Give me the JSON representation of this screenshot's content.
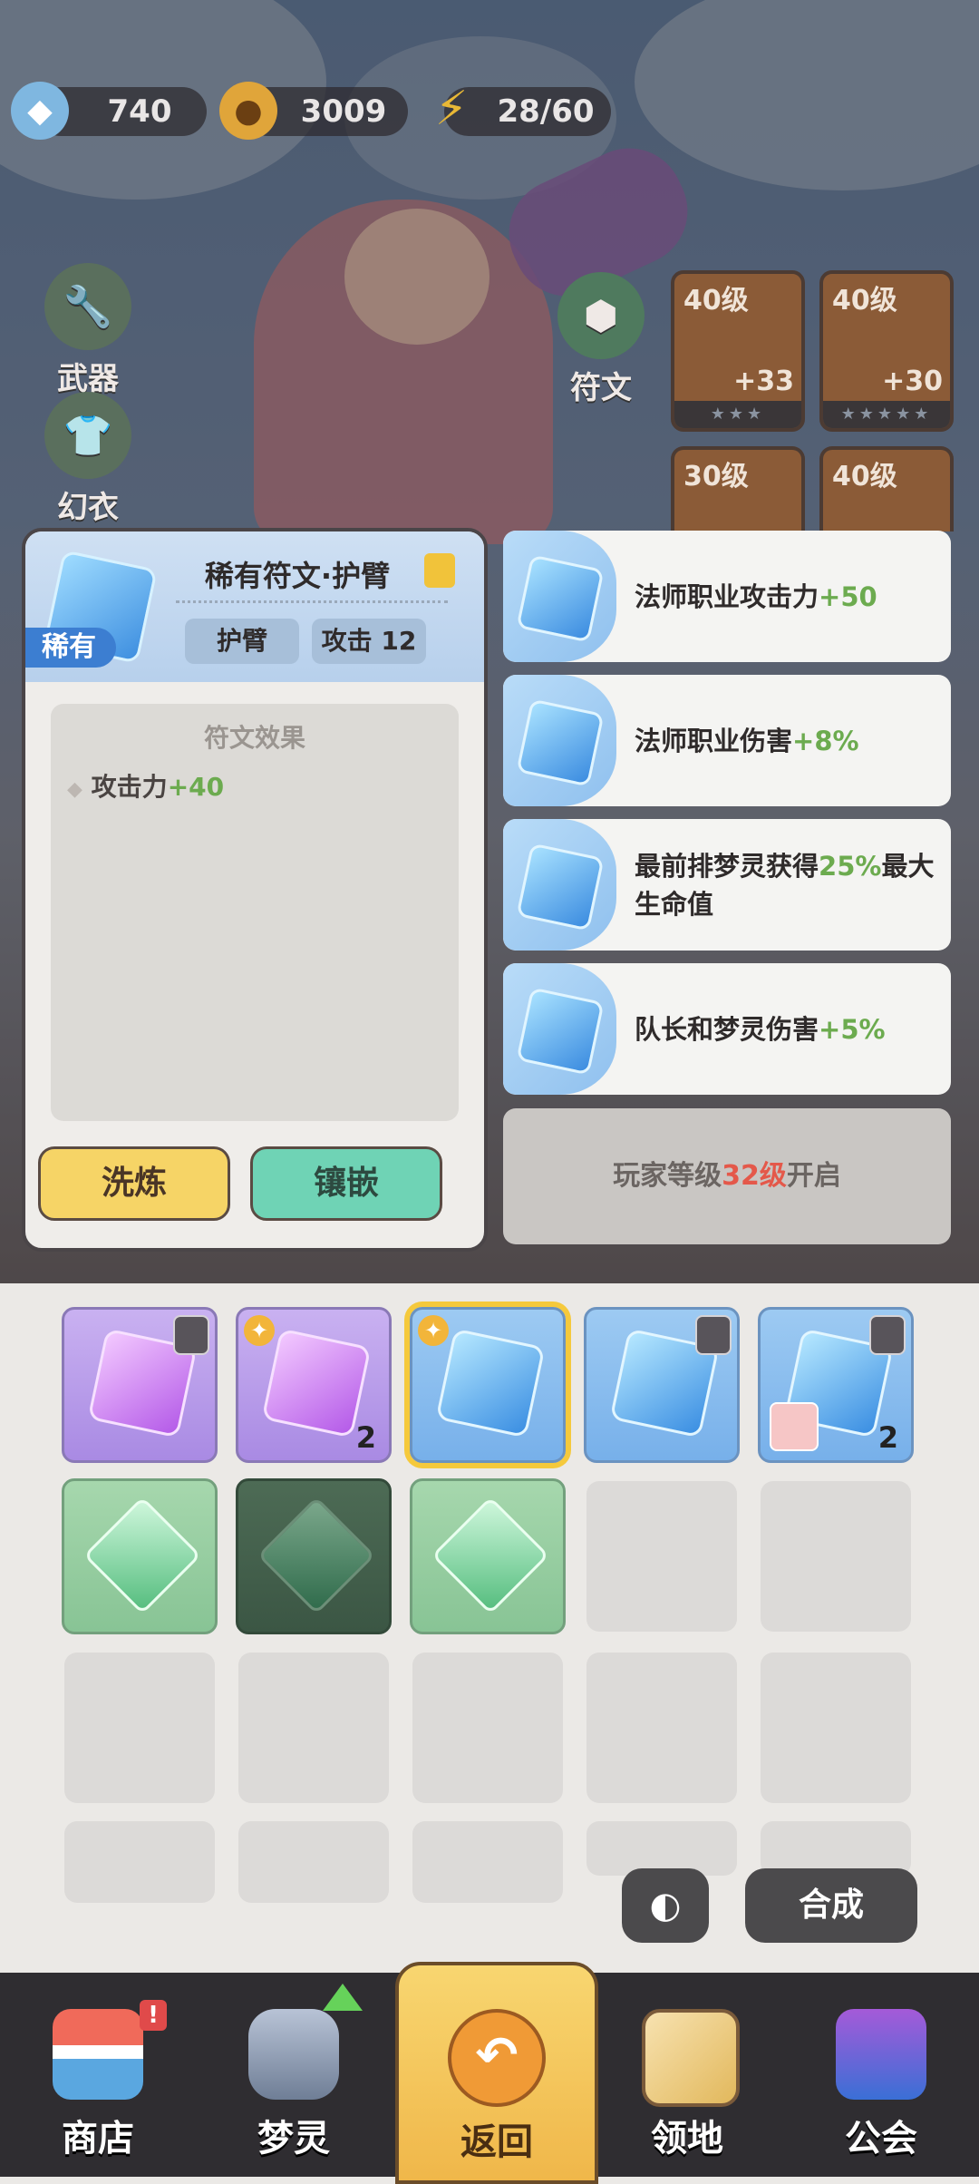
{
  "currency": {
    "gems": "740",
    "gold": "3009",
    "energy": "28/60"
  },
  "side_buttons": {
    "weapon": "武器",
    "costume": "幻衣",
    "rune": "符文"
  },
  "equipment": [
    {
      "level": "40级",
      "plus": "+33"
    },
    {
      "level": "40级",
      "plus": "+30"
    },
    {
      "level": "30级",
      "plus": ""
    },
    {
      "level": "40级",
      "plus": ""
    }
  ],
  "detail": {
    "rarity_tag": "稀有",
    "title": "稀有符文·护臂",
    "slot_chip": "护臂",
    "attack_chip": "攻击 12",
    "effect_title": "符文效果",
    "effect_label": "攻击力",
    "effect_value": "+40",
    "refine_button": "洗炼",
    "inlay_button": "镶嵌"
  },
  "effects": [
    {
      "text": "法师职业攻击力",
      "value": "+50",
      "suffix": ""
    },
    {
      "text": "法师职业伤害",
      "value": "+8%",
      "suffix": ""
    },
    {
      "text": "最前排梦灵获得",
      "value": "25%",
      "suffix": "最大生命值"
    },
    {
      "text": "队长和梦灵伤害",
      "value": "+5%",
      "suffix": ""
    }
  ],
  "locked_slot": {
    "prefix": "玩家等级",
    "level": "32级",
    "suffix": "开启"
  },
  "inventory_counts": {
    "purple_2": "2",
    "blue_5": "2"
  },
  "controls": {
    "merge_button": "合成"
  },
  "nav": {
    "shop": "商店",
    "spirit": "梦灵",
    "back": "返回",
    "territory": "领地",
    "guild": "公会",
    "shop_badge": "!"
  },
  "colors": {
    "green_value": "#6cab4f",
    "red_value": "#e4584a",
    "accent_yellow": "#f5c93c"
  }
}
